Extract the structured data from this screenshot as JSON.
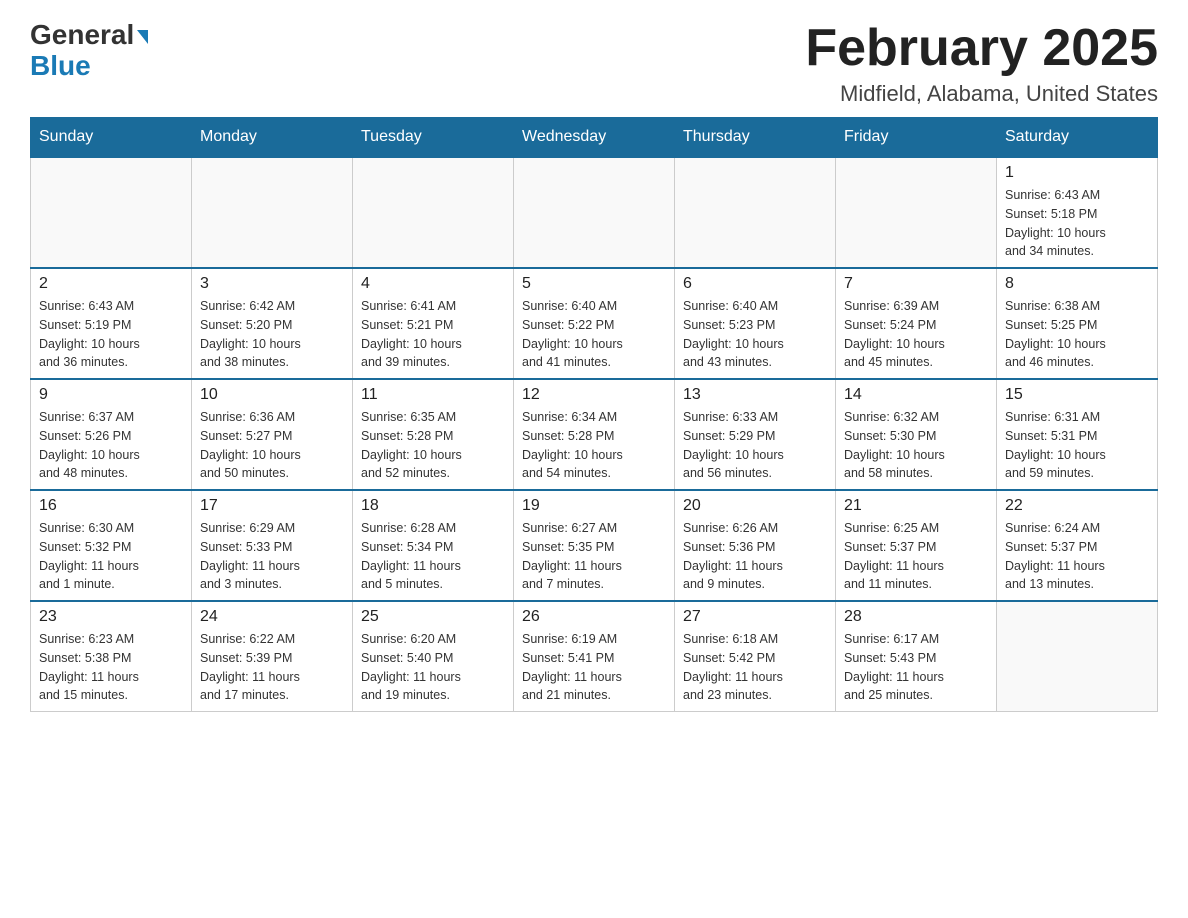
{
  "header": {
    "logo_general": "General",
    "logo_blue": "Blue",
    "month_title": "February 2025",
    "location": "Midfield, Alabama, United States"
  },
  "days_of_week": [
    "Sunday",
    "Monday",
    "Tuesday",
    "Wednesday",
    "Thursday",
    "Friday",
    "Saturday"
  ],
  "weeks": [
    [
      {
        "num": "",
        "info": ""
      },
      {
        "num": "",
        "info": ""
      },
      {
        "num": "",
        "info": ""
      },
      {
        "num": "",
        "info": ""
      },
      {
        "num": "",
        "info": ""
      },
      {
        "num": "",
        "info": ""
      },
      {
        "num": "1",
        "info": "Sunrise: 6:43 AM\nSunset: 5:18 PM\nDaylight: 10 hours\nand 34 minutes."
      }
    ],
    [
      {
        "num": "2",
        "info": "Sunrise: 6:43 AM\nSunset: 5:19 PM\nDaylight: 10 hours\nand 36 minutes."
      },
      {
        "num": "3",
        "info": "Sunrise: 6:42 AM\nSunset: 5:20 PM\nDaylight: 10 hours\nand 38 minutes."
      },
      {
        "num": "4",
        "info": "Sunrise: 6:41 AM\nSunset: 5:21 PM\nDaylight: 10 hours\nand 39 minutes."
      },
      {
        "num": "5",
        "info": "Sunrise: 6:40 AM\nSunset: 5:22 PM\nDaylight: 10 hours\nand 41 minutes."
      },
      {
        "num": "6",
        "info": "Sunrise: 6:40 AM\nSunset: 5:23 PM\nDaylight: 10 hours\nand 43 minutes."
      },
      {
        "num": "7",
        "info": "Sunrise: 6:39 AM\nSunset: 5:24 PM\nDaylight: 10 hours\nand 45 minutes."
      },
      {
        "num": "8",
        "info": "Sunrise: 6:38 AM\nSunset: 5:25 PM\nDaylight: 10 hours\nand 46 minutes."
      }
    ],
    [
      {
        "num": "9",
        "info": "Sunrise: 6:37 AM\nSunset: 5:26 PM\nDaylight: 10 hours\nand 48 minutes."
      },
      {
        "num": "10",
        "info": "Sunrise: 6:36 AM\nSunset: 5:27 PM\nDaylight: 10 hours\nand 50 minutes."
      },
      {
        "num": "11",
        "info": "Sunrise: 6:35 AM\nSunset: 5:28 PM\nDaylight: 10 hours\nand 52 minutes."
      },
      {
        "num": "12",
        "info": "Sunrise: 6:34 AM\nSunset: 5:28 PM\nDaylight: 10 hours\nand 54 minutes."
      },
      {
        "num": "13",
        "info": "Sunrise: 6:33 AM\nSunset: 5:29 PM\nDaylight: 10 hours\nand 56 minutes."
      },
      {
        "num": "14",
        "info": "Sunrise: 6:32 AM\nSunset: 5:30 PM\nDaylight: 10 hours\nand 58 minutes."
      },
      {
        "num": "15",
        "info": "Sunrise: 6:31 AM\nSunset: 5:31 PM\nDaylight: 10 hours\nand 59 minutes."
      }
    ],
    [
      {
        "num": "16",
        "info": "Sunrise: 6:30 AM\nSunset: 5:32 PM\nDaylight: 11 hours\nand 1 minute."
      },
      {
        "num": "17",
        "info": "Sunrise: 6:29 AM\nSunset: 5:33 PM\nDaylight: 11 hours\nand 3 minutes."
      },
      {
        "num": "18",
        "info": "Sunrise: 6:28 AM\nSunset: 5:34 PM\nDaylight: 11 hours\nand 5 minutes."
      },
      {
        "num": "19",
        "info": "Sunrise: 6:27 AM\nSunset: 5:35 PM\nDaylight: 11 hours\nand 7 minutes."
      },
      {
        "num": "20",
        "info": "Sunrise: 6:26 AM\nSunset: 5:36 PM\nDaylight: 11 hours\nand 9 minutes."
      },
      {
        "num": "21",
        "info": "Sunrise: 6:25 AM\nSunset: 5:37 PM\nDaylight: 11 hours\nand 11 minutes."
      },
      {
        "num": "22",
        "info": "Sunrise: 6:24 AM\nSunset: 5:37 PM\nDaylight: 11 hours\nand 13 minutes."
      }
    ],
    [
      {
        "num": "23",
        "info": "Sunrise: 6:23 AM\nSunset: 5:38 PM\nDaylight: 11 hours\nand 15 minutes."
      },
      {
        "num": "24",
        "info": "Sunrise: 6:22 AM\nSunset: 5:39 PM\nDaylight: 11 hours\nand 17 minutes."
      },
      {
        "num": "25",
        "info": "Sunrise: 6:20 AM\nSunset: 5:40 PM\nDaylight: 11 hours\nand 19 minutes."
      },
      {
        "num": "26",
        "info": "Sunrise: 6:19 AM\nSunset: 5:41 PM\nDaylight: 11 hours\nand 21 minutes."
      },
      {
        "num": "27",
        "info": "Sunrise: 6:18 AM\nSunset: 5:42 PM\nDaylight: 11 hours\nand 23 minutes."
      },
      {
        "num": "28",
        "info": "Sunrise: 6:17 AM\nSunset: 5:43 PM\nDaylight: 11 hours\nand 25 minutes."
      },
      {
        "num": "",
        "info": ""
      }
    ]
  ]
}
